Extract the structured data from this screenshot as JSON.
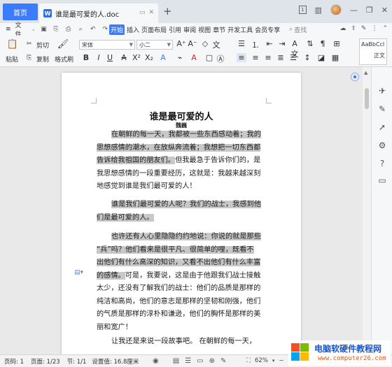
{
  "titlebar": {
    "home_tab": "首页",
    "doc_tab": "谁是最可爱的人.doc",
    "doc_icon": "W",
    "new_tab": "+",
    "win_badge": "1"
  },
  "menu": {
    "file": "文件",
    "tabs": [
      "开始",
      "插入",
      "页面布局",
      "引用",
      "审阅",
      "视图",
      "章节",
      "开发工具",
      "会员专享"
    ],
    "active_tab": "开始",
    "search": "查找"
  },
  "ribbon": {
    "paste": "粘贴",
    "cut": "剪切",
    "copy": "复制",
    "format_painter": "格式刷",
    "font_name": "宋体",
    "font_size": "小二",
    "style_preview": "AaBbCcI",
    "style_name": "正文",
    "style_preview_color": "#333333"
  },
  "document": {
    "title": "谁是最可爱的人",
    "author": "魏巍",
    "paragraphs": [
      [
        {
          "t": "在朝鲜的每一天，我都被一些东西感动着；我的",
          "hl": true
        },
        {
          "t": "思想感情的潮水，在放纵奔流着；我想把一切东西都",
          "hl": true
        },
        {
          "t": "告诉给我祖国的朋友们。",
          "hl": true,
          "tail": "但我最急于告诉你们的，是"
        },
        {
          "t": "",
          "hl": false,
          "tail": "我思想感情的一段重要经历，这就是：我越来越深刻"
        },
        {
          "t": "",
          "hl": false,
          "tail": "地感觉到谁是我们最可爱的人！"
        }
      ],
      [
        {
          "t": "谁是我们最可爱的人呢？我们的战士，我感到他",
          "hl": true
        },
        {
          "t": "们是最可爱的人。",
          "hl": true
        }
      ],
      [
        {
          "t": "也许还有人心里隐隐约约地说：你说的就是那些",
          "hl": true
        },
        {
          "t": "“兵”吗？他们看来是很平凡、很简单的哩，既看不",
          "hl": true
        },
        {
          "t": "出他们有什么高深的知识，又看不出他们有什么丰富",
          "hl": true
        },
        {
          "t": "的感情。",
          "hl": true,
          "tail": "可是，我要说，这是由于他跟我们战士接触"
        },
        {
          "t": "",
          "hl": false,
          "tail": "太少，还没有了解我们的战士：他们的品质是那样的"
        },
        {
          "t": "",
          "hl": false,
          "tail": "纯洁和高尚，他们的意志是那样的坚韧和刚强，他们"
        },
        {
          "t": "",
          "hl": false,
          "tail": "的气质是那样的淳朴和谦逊，他们的胸怀是那样的美"
        },
        {
          "t": "",
          "hl": false,
          "tail": "丽和宽广！"
        }
      ],
      [
        {
          "t": "",
          "hl": false,
          "tail": "让我还是来说一段故事吧。  在朝鲜的每一天，"
        }
      ]
    ]
  },
  "status": {
    "page_code": "页码: 1",
    "page": "页面: 1/23",
    "section": "节: 1/1",
    "position": "设置值: 16.8厘米",
    "zoom": "62%"
  },
  "watermark": {
    "line1": "电脑软硬件教程网",
    "line2": "www.computer26.com"
  }
}
